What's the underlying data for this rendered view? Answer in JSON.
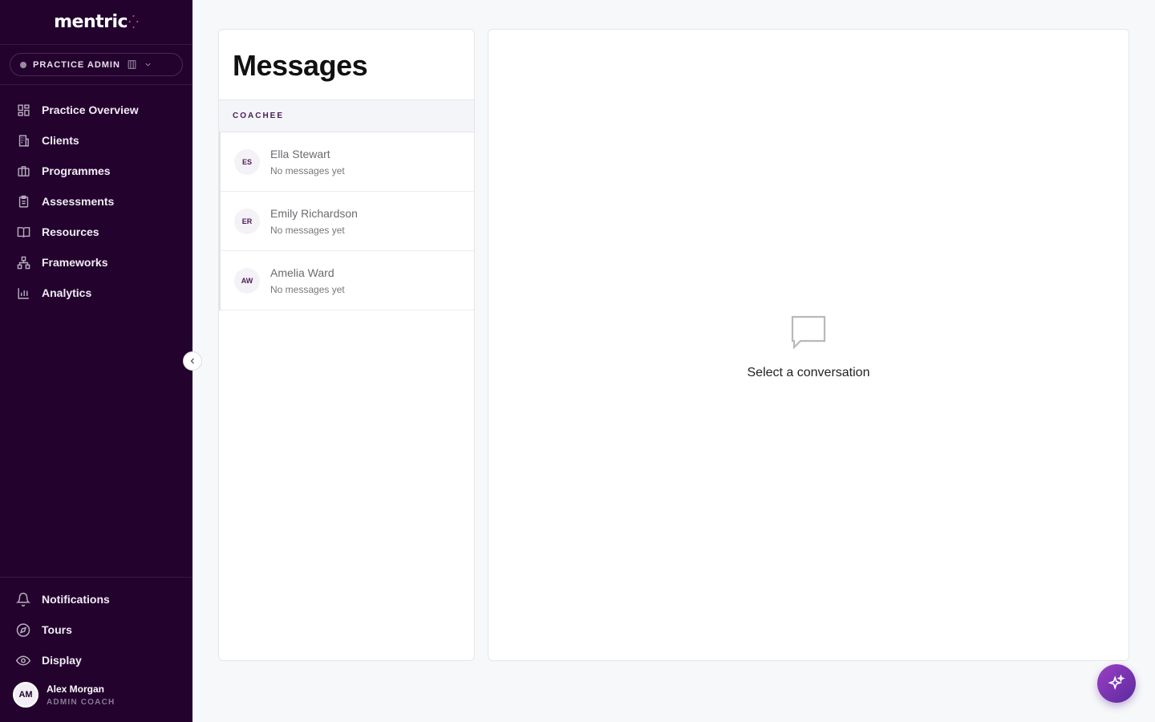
{
  "app": {
    "logo_text": "mentric",
    "brand_color": "#23022e",
    "accent_color": "#e0457b"
  },
  "role_switcher": {
    "label": "PRACTICE ADMIN"
  },
  "sidebar": {
    "items": [
      {
        "label": "Practice Overview",
        "icon": "grid-icon"
      },
      {
        "label": "Clients",
        "icon": "building-icon"
      },
      {
        "label": "Programmes",
        "icon": "briefcase-icon"
      },
      {
        "label": "Assessments",
        "icon": "clipboard-icon"
      },
      {
        "label": "Resources",
        "icon": "book-icon"
      },
      {
        "label": "Frameworks",
        "icon": "hierarchy-icon"
      },
      {
        "label": "Analytics",
        "icon": "bar-chart-icon"
      }
    ],
    "bottom_items": [
      {
        "label": "Notifications",
        "icon": "bell-icon"
      },
      {
        "label": "Tours",
        "icon": "compass-icon"
      },
      {
        "label": "Display",
        "icon": "eye-icon"
      }
    ],
    "user": {
      "initials": "AM",
      "name": "Alex Morgan",
      "role": "ADMIN COACH"
    }
  },
  "messages": {
    "title": "Messages",
    "section_label": "COACHEE",
    "conversations": [
      {
        "initials": "ES",
        "name": "Ella Stewart",
        "preview": "No messages yet"
      },
      {
        "initials": "ER",
        "name": "Emily Richardson",
        "preview": "No messages yet"
      },
      {
        "initials": "AW",
        "name": "Amelia Ward",
        "preview": "No messages yet"
      }
    ]
  },
  "conversation_panel": {
    "empty_text": "Select a conversation",
    "empty_icon": "chat-bubble-icon"
  },
  "fab": {
    "icon": "sparkles-icon"
  }
}
